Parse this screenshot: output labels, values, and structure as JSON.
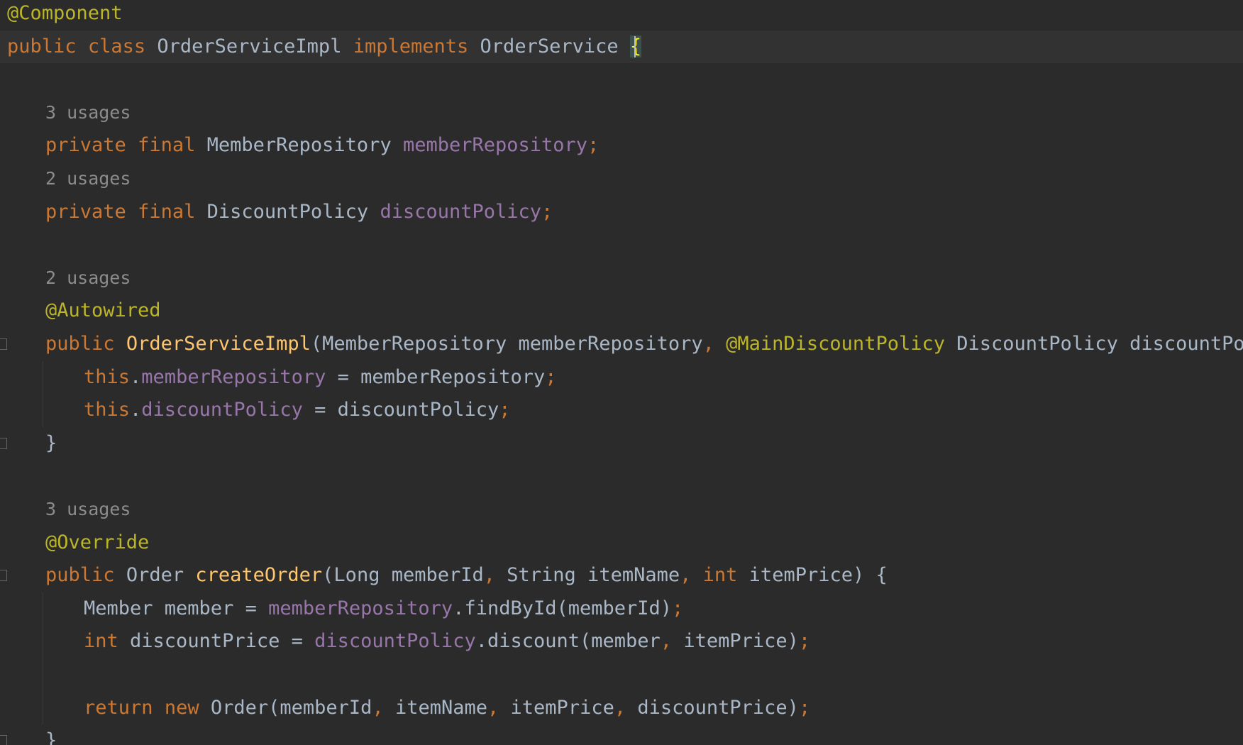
{
  "editor": {
    "language": "java",
    "theme_colors": {
      "background": "#2b2b2b",
      "keyword": "#cc7832",
      "annotation": "#bbb529",
      "field": "#9876aa",
      "method": "#ffc66d",
      "text": "#a9b7c6",
      "hint": "#8c8c8c"
    },
    "lines": [
      {
        "indent": 0,
        "current": false,
        "tokens": [
          {
            "t": "@Component",
            "c": "ann"
          }
        ]
      },
      {
        "indent": 0,
        "current": true,
        "tokens": [
          {
            "t": "public",
            "c": "kw"
          },
          {
            "t": " ",
            "c": "plain"
          },
          {
            "t": "class",
            "c": "kw"
          },
          {
            "t": " ",
            "c": "plain"
          },
          {
            "t": "OrderServiceImpl",
            "c": "type"
          },
          {
            "t": " ",
            "c": "plain"
          },
          {
            "t": "implements",
            "c": "kw"
          },
          {
            "t": " ",
            "c": "plain"
          },
          {
            "t": "OrderService",
            "c": "type"
          },
          {
            "t": " ",
            "c": "plain"
          },
          {
            "t": "{",
            "c": "brace-hl"
          },
          {
            "t": "",
            "c": "caret"
          }
        ]
      },
      {
        "indent": 0,
        "current": false,
        "tokens": []
      },
      {
        "indent": 1,
        "current": false,
        "tokens": [
          {
            "t": "3 usages",
            "c": "usage"
          }
        ]
      },
      {
        "indent": 1,
        "current": false,
        "tokens": [
          {
            "t": "private",
            "c": "kw"
          },
          {
            "t": " ",
            "c": "plain"
          },
          {
            "t": "final",
            "c": "kw"
          },
          {
            "t": " ",
            "c": "plain"
          },
          {
            "t": "MemberRepository",
            "c": "type"
          },
          {
            "t": " ",
            "c": "plain"
          },
          {
            "t": "memberRepository",
            "c": "field"
          },
          {
            "t": ";",
            "c": "punct"
          }
        ]
      },
      {
        "indent": 1,
        "current": false,
        "tokens": [
          {
            "t": "2 usages",
            "c": "usage"
          }
        ]
      },
      {
        "indent": 1,
        "current": false,
        "tokens": [
          {
            "t": "private",
            "c": "kw"
          },
          {
            "t": " ",
            "c": "plain"
          },
          {
            "t": "final",
            "c": "kw"
          },
          {
            "t": " ",
            "c": "plain"
          },
          {
            "t": "DiscountPolicy",
            "c": "type"
          },
          {
            "t": " ",
            "c": "plain"
          },
          {
            "t": "discountPolicy",
            "c": "field"
          },
          {
            "t": ";",
            "c": "punct"
          }
        ]
      },
      {
        "indent": 0,
        "current": false,
        "tokens": []
      },
      {
        "indent": 1,
        "current": false,
        "tokens": [
          {
            "t": "2 usages",
            "c": "usage"
          }
        ]
      },
      {
        "indent": 1,
        "current": false,
        "tokens": [
          {
            "t": "@Autowired",
            "c": "ann"
          }
        ]
      },
      {
        "indent": 1,
        "current": false,
        "fold": true,
        "tokens": [
          {
            "t": "public",
            "c": "kw"
          },
          {
            "t": " ",
            "c": "plain"
          },
          {
            "t": "OrderServiceImpl",
            "c": "method"
          },
          {
            "t": "(MemberRepository memberRepository",
            "c": "plain"
          },
          {
            "t": ",",
            "c": "punct"
          },
          {
            "t": " ",
            "c": "plain"
          },
          {
            "t": "@MainDiscountPolicy",
            "c": "ann"
          },
          {
            "t": " ",
            "c": "plain"
          },
          {
            "t": "DiscountPolicy discountPolicy) {",
            "c": "plain"
          }
        ]
      },
      {
        "indent": 2,
        "current": false,
        "tokens": [
          {
            "t": "this",
            "c": "kw"
          },
          {
            "t": ".",
            "c": "plain"
          },
          {
            "t": "memberRepository",
            "c": "field"
          },
          {
            "t": " = memberRepository",
            "c": "plain"
          },
          {
            "t": ";",
            "c": "punct"
          }
        ]
      },
      {
        "indent": 2,
        "current": false,
        "tokens": [
          {
            "t": "this",
            "c": "kw"
          },
          {
            "t": ".",
            "c": "plain"
          },
          {
            "t": "discountPolicy",
            "c": "field"
          },
          {
            "t": " = discountPolicy",
            "c": "plain"
          },
          {
            "t": ";",
            "c": "punct"
          }
        ]
      },
      {
        "indent": 1,
        "current": false,
        "fold": true,
        "tokens": [
          {
            "t": "}",
            "c": "plain"
          }
        ]
      },
      {
        "indent": 0,
        "current": false,
        "tokens": []
      },
      {
        "indent": 1,
        "current": false,
        "tokens": [
          {
            "t": "3 usages",
            "c": "usage"
          }
        ]
      },
      {
        "indent": 1,
        "current": false,
        "tokens": [
          {
            "t": "@Override",
            "c": "ann"
          }
        ]
      },
      {
        "indent": 1,
        "current": false,
        "fold": true,
        "tokens": [
          {
            "t": "public",
            "c": "kw"
          },
          {
            "t": " ",
            "c": "plain"
          },
          {
            "t": "Order",
            "c": "type"
          },
          {
            "t": " ",
            "c": "plain"
          },
          {
            "t": "createOrder",
            "c": "method"
          },
          {
            "t": "(Long memberId",
            "c": "plain"
          },
          {
            "t": ",",
            "c": "punct"
          },
          {
            "t": " String itemName",
            "c": "plain"
          },
          {
            "t": ",",
            "c": "punct"
          },
          {
            "t": " ",
            "c": "plain"
          },
          {
            "t": "int",
            "c": "kw"
          },
          {
            "t": " itemPrice) {",
            "c": "plain"
          }
        ]
      },
      {
        "indent": 2,
        "current": false,
        "tokens": [
          {
            "t": "Member member = ",
            "c": "plain"
          },
          {
            "t": "memberRepository",
            "c": "field"
          },
          {
            "t": ".findById(memberId)",
            "c": "plain"
          },
          {
            "t": ";",
            "c": "punct"
          }
        ]
      },
      {
        "indent": 2,
        "current": false,
        "tokens": [
          {
            "t": "int",
            "c": "kw"
          },
          {
            "t": " discountPrice = ",
            "c": "plain"
          },
          {
            "t": "discountPolicy",
            "c": "field"
          },
          {
            "t": ".discount(member",
            "c": "plain"
          },
          {
            "t": ",",
            "c": "punct"
          },
          {
            "t": " itemPrice)",
            "c": "plain"
          },
          {
            "t": ";",
            "c": "punct"
          }
        ]
      },
      {
        "indent": 0,
        "current": false,
        "tokens": []
      },
      {
        "indent": 2,
        "current": false,
        "tokens": [
          {
            "t": "return",
            "c": "kw"
          },
          {
            "t": " ",
            "c": "plain"
          },
          {
            "t": "new",
            "c": "kw"
          },
          {
            "t": " ",
            "c": "plain"
          },
          {
            "t": "Order(memberId",
            "c": "plain"
          },
          {
            "t": ",",
            "c": "punct"
          },
          {
            "t": " itemName",
            "c": "plain"
          },
          {
            "t": ",",
            "c": "punct"
          },
          {
            "t": " itemPrice",
            "c": "plain"
          },
          {
            "t": ",",
            "c": "punct"
          },
          {
            "t": " discountPrice)",
            "c": "plain"
          },
          {
            "t": ";",
            "c": "punct"
          }
        ]
      },
      {
        "indent": 1,
        "current": false,
        "fold": true,
        "tokens": [
          {
            "t": "}",
            "c": "plain"
          }
        ]
      }
    ]
  }
}
